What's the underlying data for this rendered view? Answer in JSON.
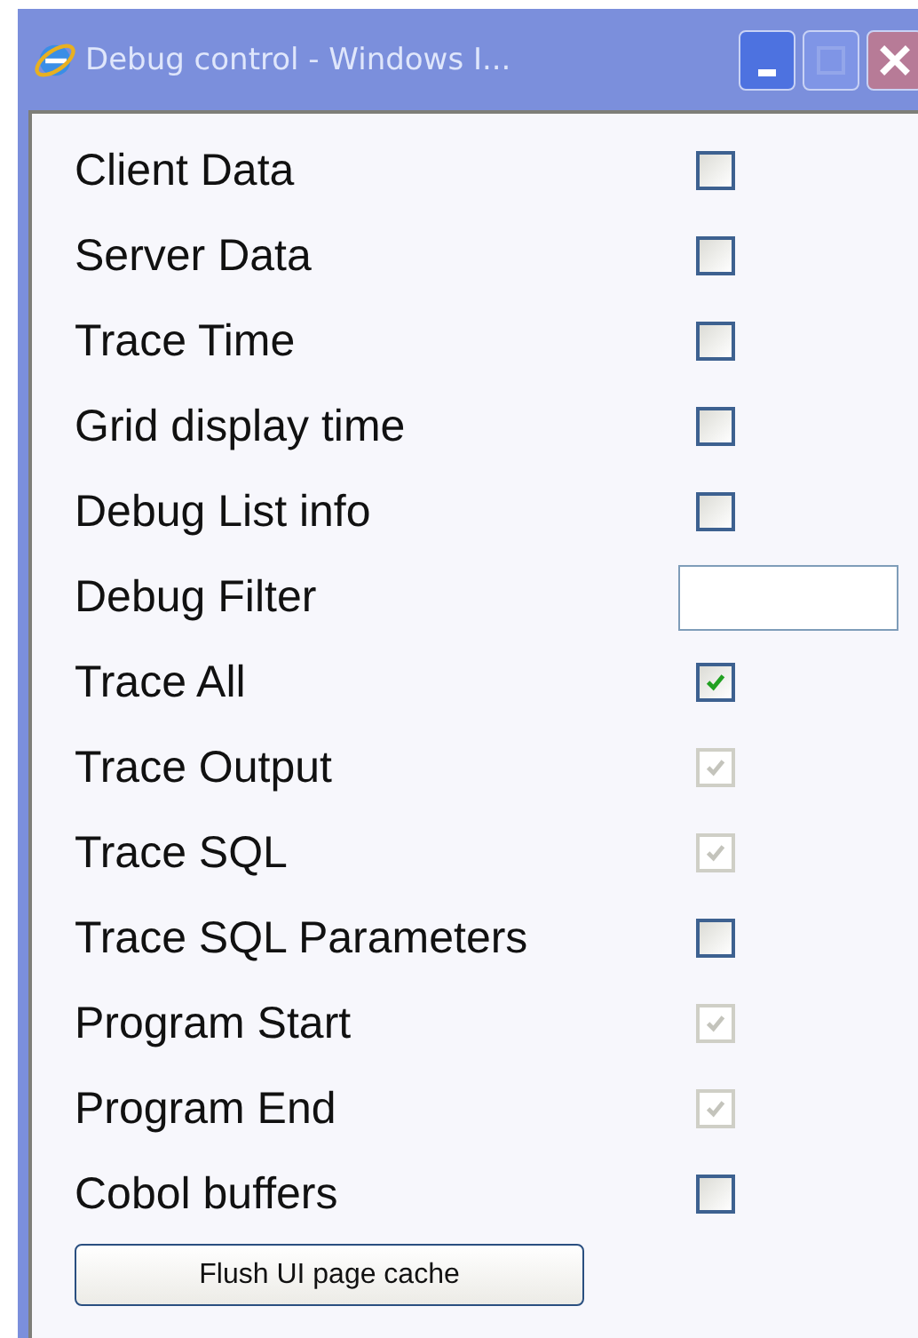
{
  "window": {
    "title": "Debug control - Windows I..."
  },
  "options": [
    {
      "kind": "checkbox",
      "label": "Client Data",
      "checked": false,
      "disabled": false
    },
    {
      "kind": "checkbox",
      "label": "Server Data",
      "checked": false,
      "disabled": false
    },
    {
      "kind": "checkbox",
      "label": "Trace Time",
      "checked": false,
      "disabled": false
    },
    {
      "kind": "checkbox",
      "label": "Grid display time",
      "checked": false,
      "disabled": false
    },
    {
      "kind": "checkbox",
      "label": "Debug List info",
      "checked": false,
      "disabled": false
    },
    {
      "kind": "text",
      "label": "Debug Filter"
    },
    {
      "kind": "checkbox",
      "label": "Trace All",
      "checked": true,
      "disabled": false
    },
    {
      "kind": "checkbox",
      "label": "Trace Output",
      "checked": true,
      "disabled": true
    },
    {
      "kind": "checkbox",
      "label": "Trace SQL",
      "checked": true,
      "disabled": true
    },
    {
      "kind": "checkbox",
      "label": "Trace SQL Parameters",
      "checked": false,
      "disabled": false
    },
    {
      "kind": "checkbox",
      "label": "Program Start",
      "checked": true,
      "disabled": true
    },
    {
      "kind": "checkbox",
      "label": "Program End",
      "checked": true,
      "disabled": true
    },
    {
      "kind": "checkbox",
      "label": "Cobol buffers",
      "checked": false,
      "disabled": false
    }
  ],
  "button": "Flush UI page cache"
}
